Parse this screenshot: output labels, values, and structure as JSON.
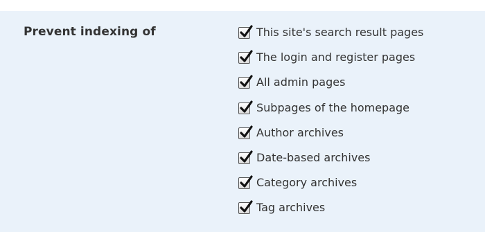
{
  "setting": {
    "label": "Prevent indexing of",
    "options": [
      {
        "label": "This site's search result pages",
        "checked": true
      },
      {
        "label": "The login and register pages",
        "checked": true
      },
      {
        "label": "All admin pages",
        "checked": true
      },
      {
        "label": "Subpages of the homepage",
        "checked": true
      },
      {
        "label": "Author archives",
        "checked": true
      },
      {
        "label": "Date-based archives",
        "checked": true
      },
      {
        "label": "Category archives",
        "checked": true
      },
      {
        "label": "Tag archives",
        "checked": true
      }
    ]
  },
  "colors": {
    "panel_background": "#eaf2fa",
    "text": "#333333",
    "checkmark": "#111111"
  }
}
